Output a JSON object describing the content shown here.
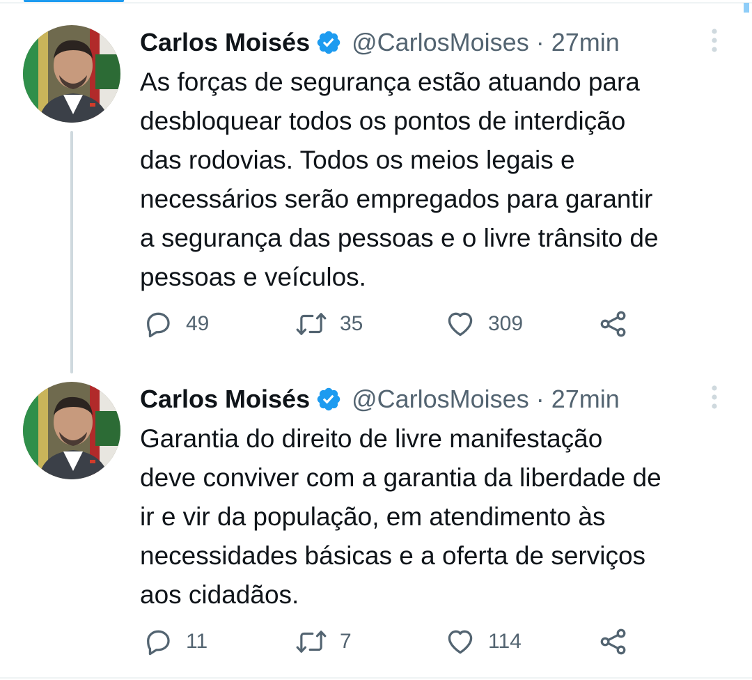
{
  "thread": {
    "tweets": [
      {
        "author": {
          "name": "Carlos Moisés",
          "handle": "@CarlosMoises",
          "verified": true
        },
        "separator": "·",
        "timestamp": "27min",
        "text_lines": [
          "As forças de segurança estão atuando para",
          "desbloquear todos os pontos de interdição",
          "das rodovias. Todos os meios legais e",
          "necessários serão empregados para garantir",
          "a segurança das pessoas e o livre trânsito de",
          "pessoas e veículos."
        ],
        "stats": {
          "replies": "49",
          "retweets": "35",
          "likes": "309"
        }
      },
      {
        "author": {
          "name": "Carlos Moisés",
          "handle": "@CarlosMoises",
          "verified": true
        },
        "separator": "·",
        "timestamp": "27min",
        "text_lines": [
          "Garantia do direito de livre manifestação",
          "deve conviver com a garantia da liberdade de",
          "ir e vir da população, em atendimento às",
          "necessidades básicas e a oferta de serviços",
          "aos cidadãos."
        ],
        "stats": {
          "replies": "11",
          "retweets": "7",
          "likes": "114"
        }
      }
    ]
  },
  "icons": {
    "reply": "reply-icon",
    "retweet": "retweet-icon",
    "like": "heart-icon",
    "share": "share-icon",
    "verified": "verified-badge-icon",
    "more": "more-options-icon"
  },
  "colors": {
    "text_primary": "#0f1419",
    "text_secondary": "#536471",
    "accent": "#1d9bf0",
    "thread_line": "#cfd9de"
  }
}
